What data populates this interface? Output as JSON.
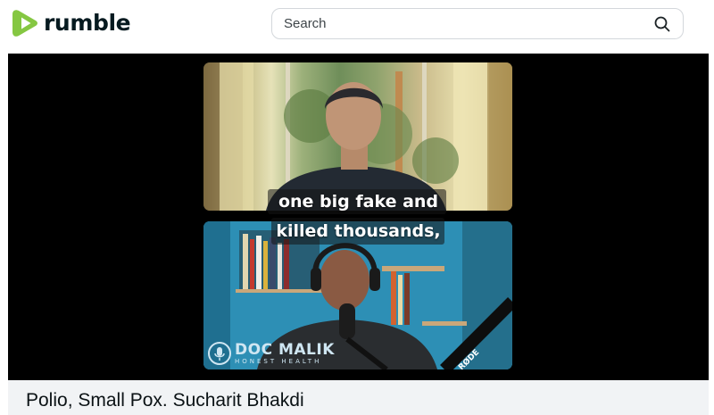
{
  "brand": {
    "name": "rumble",
    "accent_color": "#85c742",
    "icon": "rumble-play-logo-icon"
  },
  "search": {
    "placeholder": "Search",
    "icon": "search-icon"
  },
  "video": {
    "subtitle_line_1": "one big fake and",
    "subtitle_line_2": "killed thousands,",
    "watermark_name": "DOC MALIK",
    "watermark_tagline": "HONEST HEALTH",
    "microphone_brand": "RØDE",
    "title": "Polio, Small Pox. Sucharit Bhakdi"
  }
}
